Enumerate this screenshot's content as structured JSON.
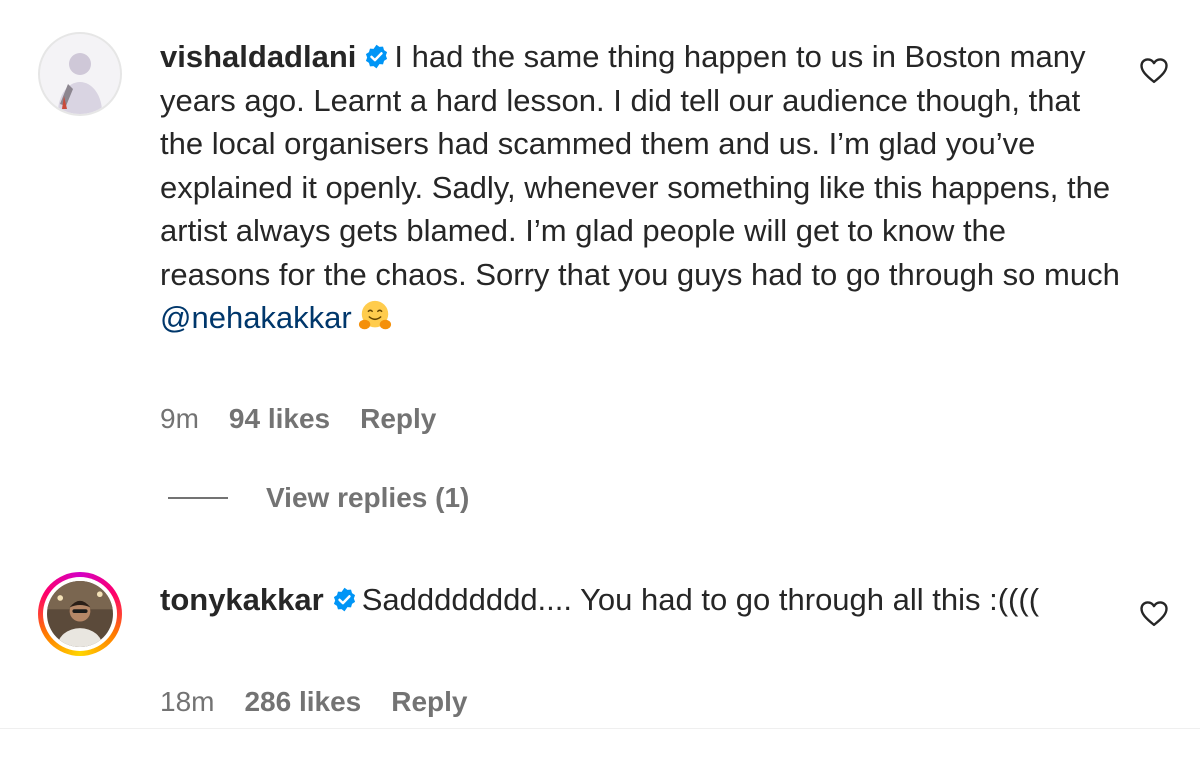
{
  "comments": [
    {
      "username": "vishaldadlani",
      "text": "I had the same thing happen to us in Boston many years ago. Learnt a hard lesson. I did tell our audience though, that the local organisers had scammed them and us. I’m glad you’ve explained it openly. Sadly, whenever something like this happens, the artist always gets blamed. I’m glad people will get to know the reasons for the chaos. Sorry that you guys had to go through so much",
      "mention": "@nehakakkar",
      "emoji": "hugging-face-emoji",
      "time": "9m",
      "likes": "94 likes",
      "reply": "Reply",
      "view_replies": "View replies (1)"
    },
    {
      "username": "tonykakkar",
      "text": "Sadddddddd.... You had to go through all this :((((",
      "time": "18m",
      "likes": "286 likes",
      "reply": "Reply"
    }
  ],
  "icons": {
    "verified": "verified-badge-icon",
    "like": "heart-outline-icon"
  },
  "colors": {
    "verified": "#0095f6",
    "mention": "#00376b",
    "secondary_text": "#737373"
  }
}
